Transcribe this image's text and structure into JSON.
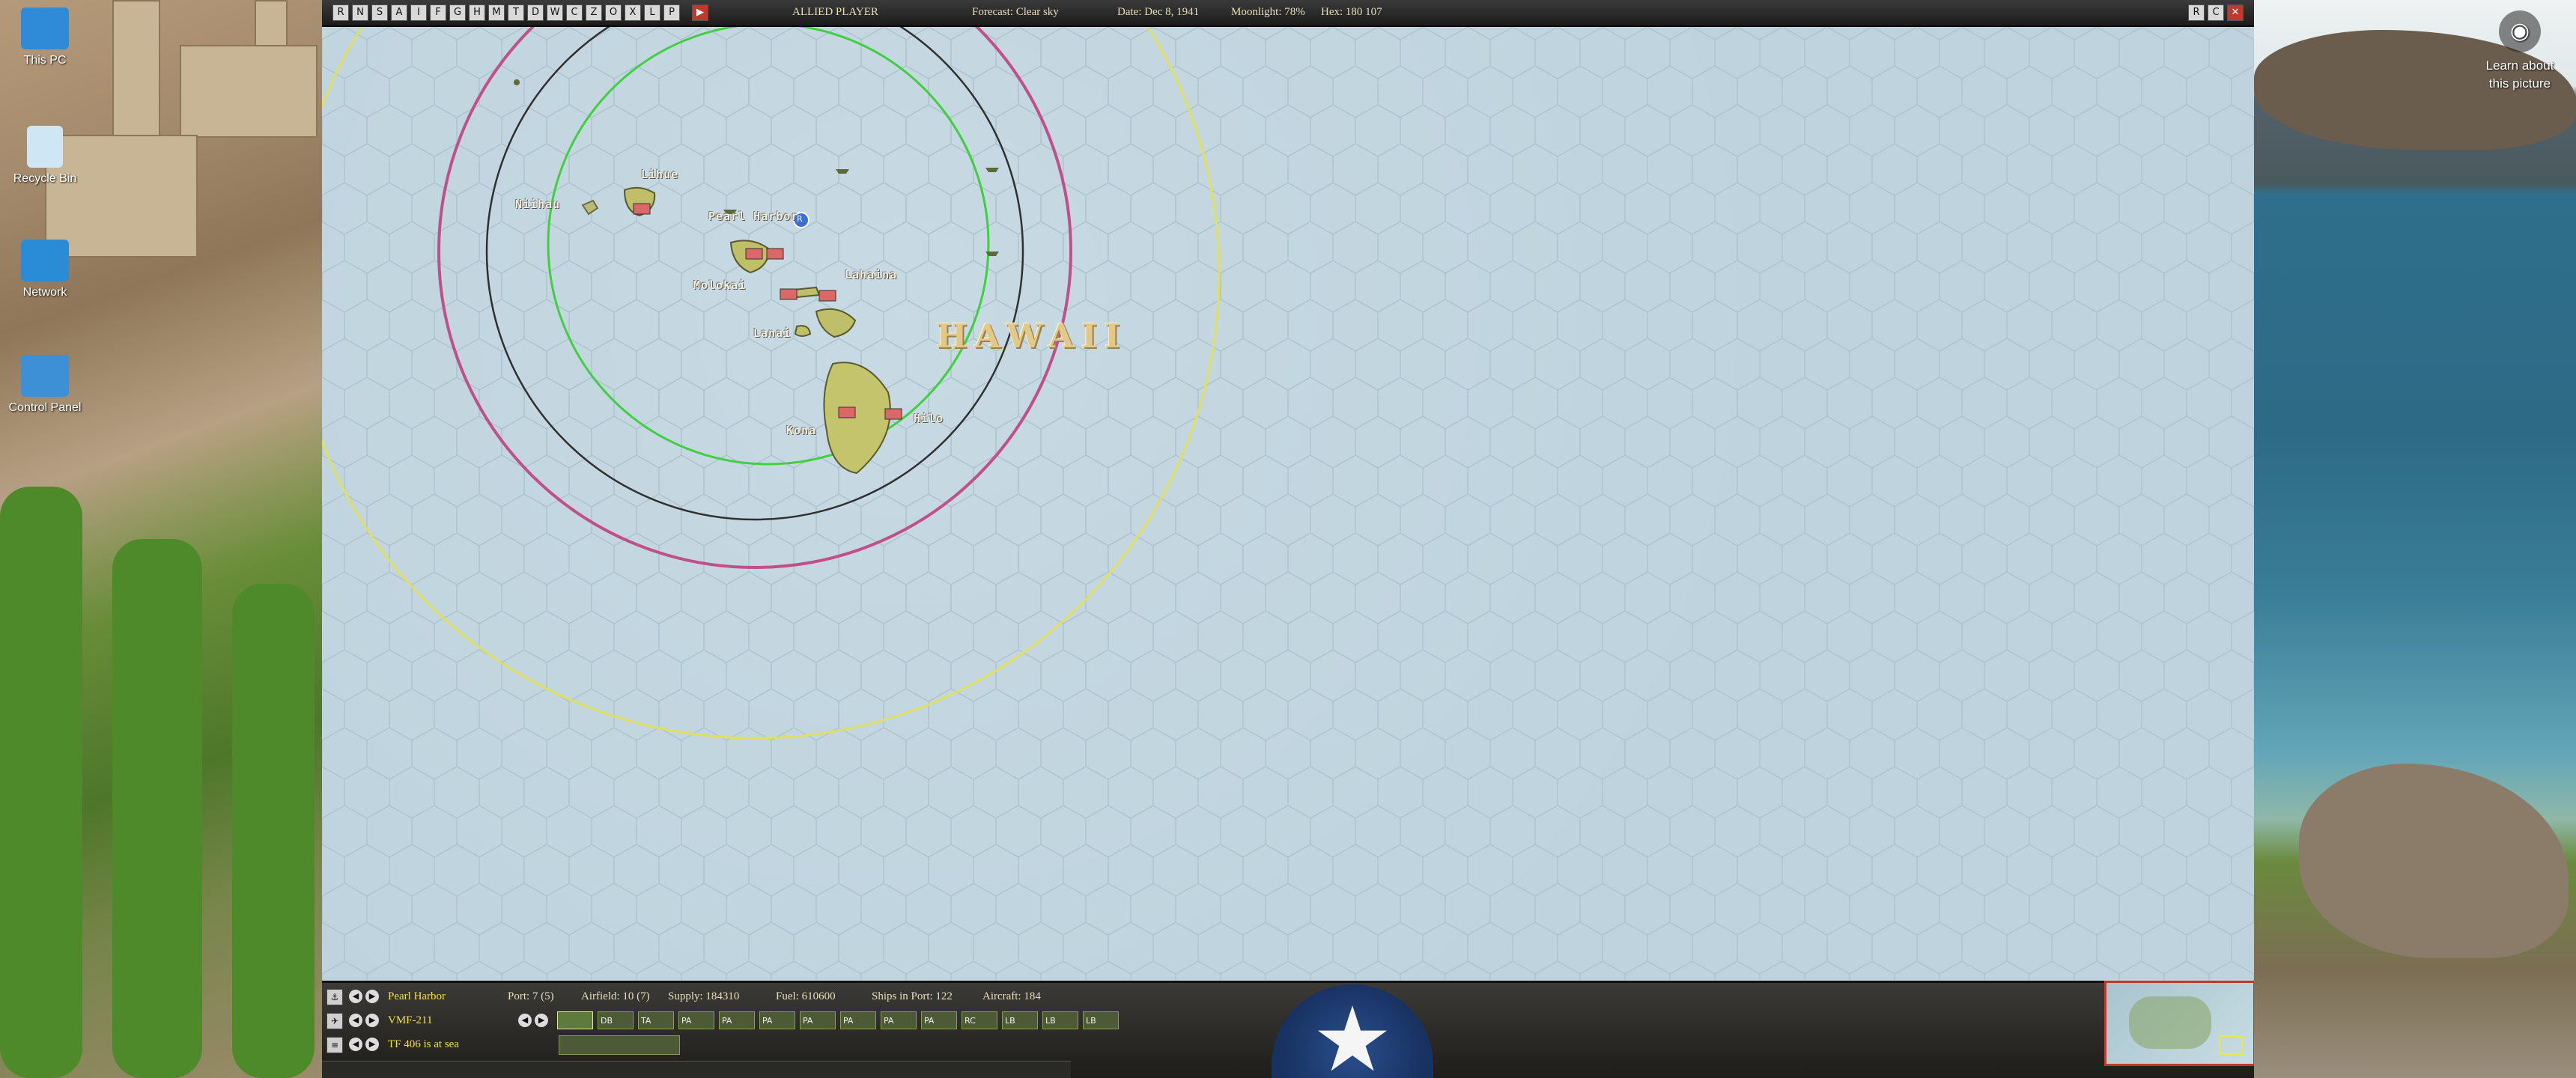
{
  "desktop": {
    "icons": [
      {
        "label": "This PC",
        "icon": "computer-icon",
        "color": "#2f8ad8"
      },
      {
        "label": "Recycle Bin",
        "icon": "recycle-bin-icon",
        "color": "#cfe6f5"
      },
      {
        "label": "Network",
        "icon": "network-icon",
        "color": "#2a8bd6"
      },
      {
        "label": "Control Panel",
        "icon": "control-panel-icon",
        "color": "#3d8fd6"
      }
    ],
    "learn_widget": {
      "label": "Learn about this picture",
      "icon": "camera-icon"
    }
  },
  "game": {
    "toolbar": {
      "buttons": [
        "R",
        "N",
        "S",
        "A",
        "I",
        "F",
        "G",
        "H",
        "M",
        "T",
        "D",
        "W",
        "C",
        "Z",
        "O",
        "X",
        "L",
        "P",
        "▶"
      ],
      "player": "ALLIED PLAYER",
      "forecast": "Forecast: Clear sky",
      "date": "Date: Dec 8, 1941",
      "moonlight": "Moonlight: 78%",
      "hex": "Hex: 180 107",
      "window_controls": [
        "R",
        "C",
        "✕"
      ],
      "accent_colors": {
        "bar": "#1c1c1c",
        "text": "#e8dfb8",
        "close": "#c0392b"
      }
    },
    "map": {
      "region_label": "HAWAII",
      "islands": [
        {
          "name": "Niihau"
        },
        {
          "name": "Lihue"
        },
        {
          "name": "Pearl Harbor",
          "badge": "R"
        },
        {
          "name": "Molokai"
        },
        {
          "name": "Lahaina"
        },
        {
          "name": "Lanai"
        },
        {
          "name": "Kona"
        },
        {
          "name": "Hilo"
        }
      ],
      "range_ring_colors": [
        "#e0e060",
        "#c0508a",
        "#303030",
        "#3fcf3f"
      ],
      "ocean_color": "#bed3de"
    },
    "bottom": {
      "base_name": "Pearl Harbor",
      "port": "Port: 7 (5)",
      "airfield": "Airfield: 10 (7)",
      "supply": "Supply: 184310",
      "fuel": "Fuel: 610600",
      "ships_in_port": "Ships in Port: 122",
      "aircraft": "Aircraft: 184",
      "unit": "VMF-211",
      "task_force": "TF 406 is at sea",
      "plane_slots": [
        "",
        "DB",
        "TA",
        "PA",
        "PA",
        "PA",
        "PA",
        "PA",
        "PA",
        "PA",
        "RC",
        "LB",
        "LB",
        "LB"
      ],
      "emblem": "★"
    }
  }
}
